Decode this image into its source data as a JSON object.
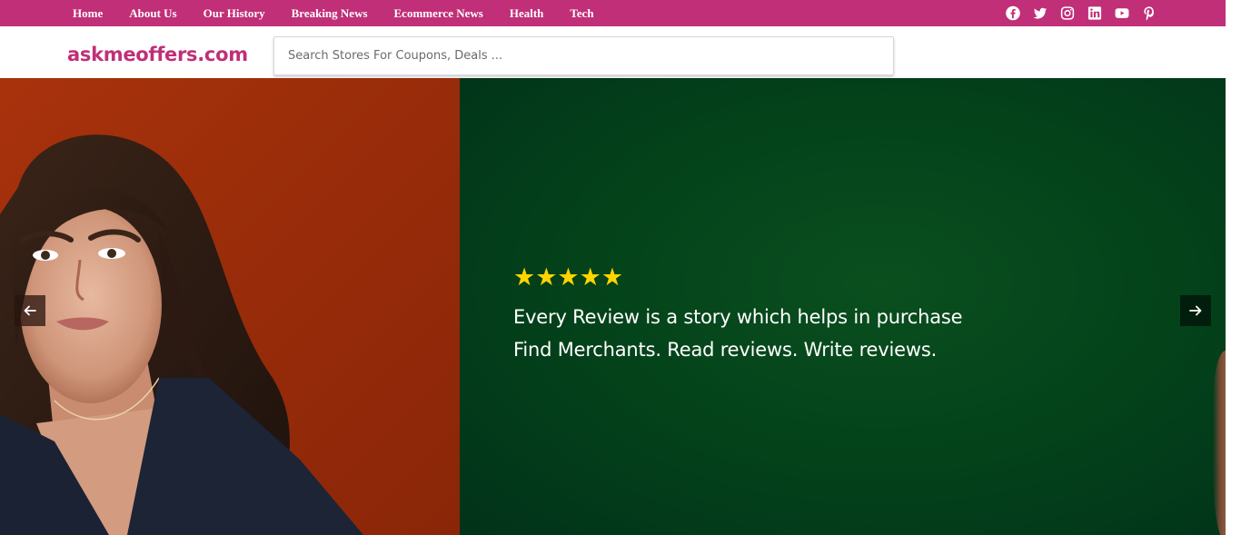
{
  "nav": {
    "items": [
      {
        "label": "Home"
      },
      {
        "label": "About Us"
      },
      {
        "label": "Our History"
      },
      {
        "label": "Breaking News"
      },
      {
        "label": "Ecommerce News"
      },
      {
        "label": "Health"
      },
      {
        "label": "Tech"
      }
    ],
    "social_icons": [
      "facebook-icon",
      "twitter-icon",
      "instagram-icon",
      "linkedin-icon",
      "youtube-icon",
      "pinterest-icon"
    ]
  },
  "header": {
    "logo": "askmeoffers.com",
    "search_placeholder": "Search Stores For Coupons, Deals ..."
  },
  "hero": {
    "rating_stars": 5,
    "rating_text": "★★★★★",
    "headline": "Every Review is a story which helps in purchase",
    "subline": "Find Merchants. Read reviews. Write reviews.",
    "prev_icon": "arrow-left-icon",
    "next_icon": "arrow-right-icon"
  },
  "colors": {
    "brand": "#c02f78",
    "hero_left_bg": "#9b2d0a",
    "hero_right_bg": "#03411a",
    "star": "#ffd400"
  }
}
